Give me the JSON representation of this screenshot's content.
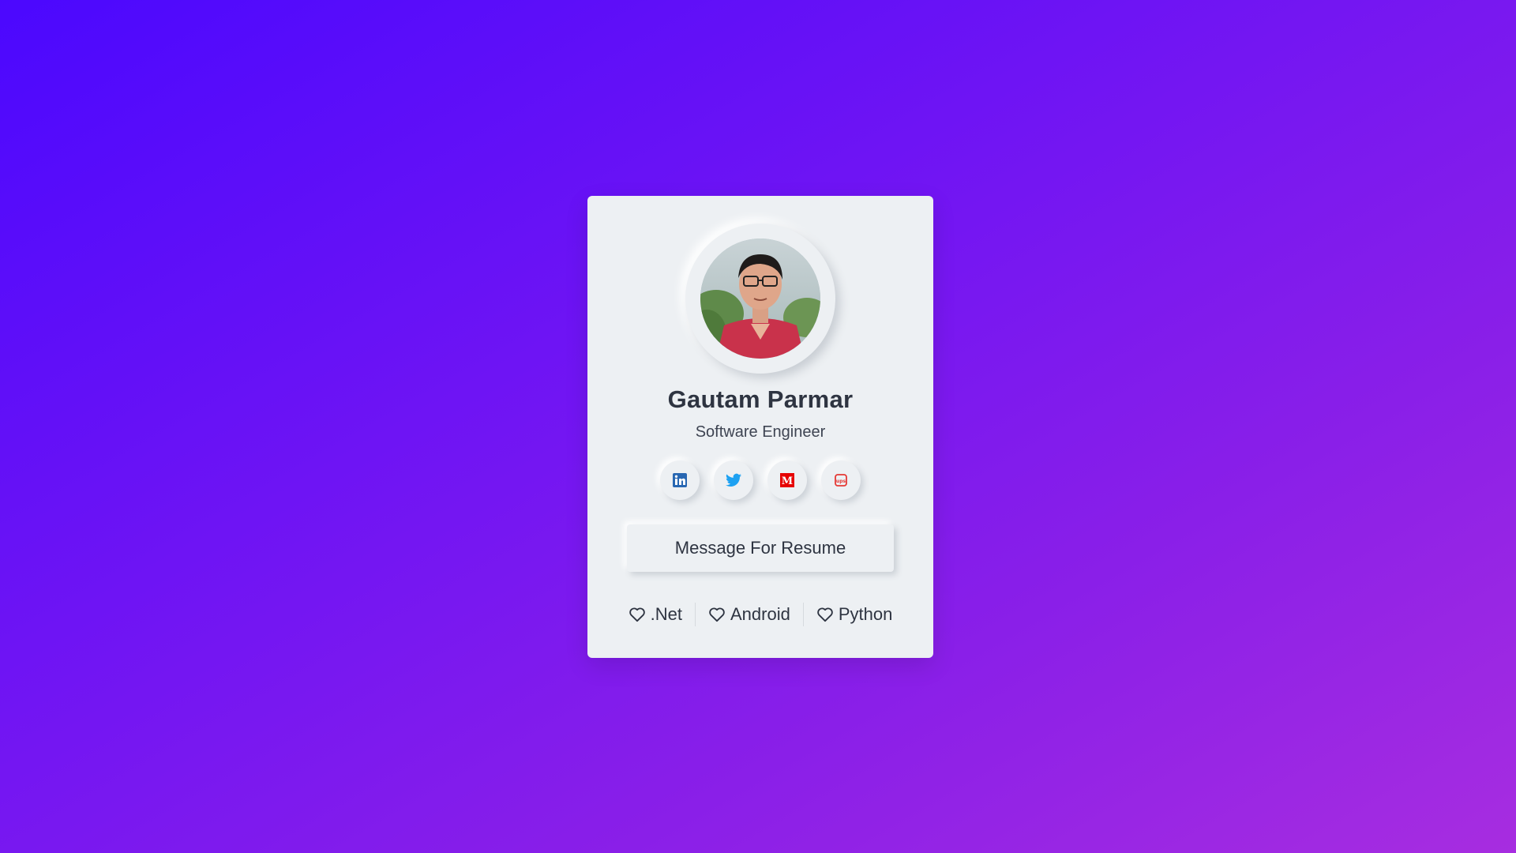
{
  "profile": {
    "name": "Gautam Parmar",
    "role": "Software Engineer",
    "avatar_icon": "profile-photo"
  },
  "social": [
    {
      "name": "linkedin",
      "icon": "linkedin-icon",
      "color": "#2867b2"
    },
    {
      "name": "twitter",
      "icon": "twitter-icon",
      "color": "#1da1f2"
    },
    {
      "name": "gmail",
      "icon": "gmail-icon",
      "color": "#e60000"
    },
    {
      "name": "stack",
      "icon": "stack-icon",
      "color": "#e53935"
    }
  ],
  "resume_button": {
    "label": "Message For Resume"
  },
  "skills": [
    {
      "label": ".Net",
      "icon": "heart-icon"
    },
    {
      "label": "Android",
      "icon": "heart-icon"
    },
    {
      "label": "Python",
      "icon": "heart-icon"
    }
  ],
  "colors": {
    "background_start": "#4b08fe",
    "background_end": "#a72de0",
    "card": "#edf0f3",
    "text": "#2e3441"
  }
}
